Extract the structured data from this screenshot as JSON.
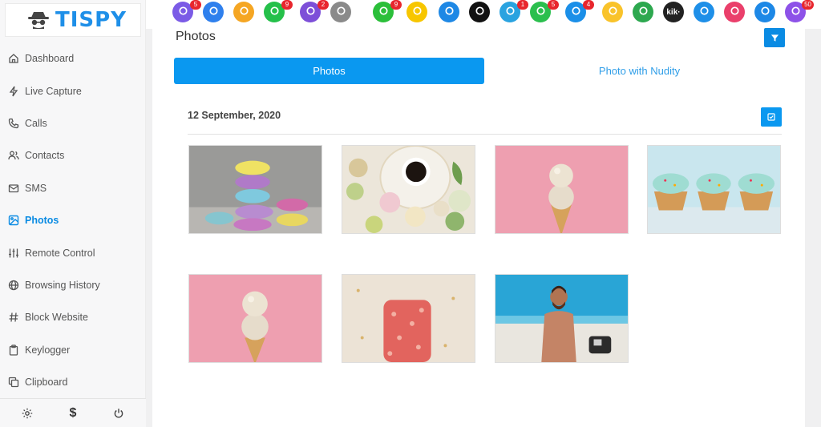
{
  "brand": {
    "name": "TISPY",
    "accent": "#1e8fe8"
  },
  "nav": {
    "items": [
      {
        "label": "Dashboard",
        "icon": "home-icon"
      },
      {
        "label": "Live Capture",
        "icon": "bolt-icon"
      },
      {
        "label": "Calls",
        "icon": "phone-icon"
      },
      {
        "label": "Contacts",
        "icon": "users-icon"
      },
      {
        "label": "SMS",
        "icon": "mail-icon"
      },
      {
        "label": "Photos",
        "icon": "image-icon",
        "active": true
      },
      {
        "label": "Remote Control",
        "icon": "sliders-icon"
      },
      {
        "label": "Browsing History",
        "icon": "globe-icon"
      },
      {
        "label": "Block Website",
        "icon": "hash-icon"
      },
      {
        "label": "Keylogger",
        "icon": "clipboard-icon"
      },
      {
        "label": "Clipboard",
        "icon": "copy-icon"
      }
    ],
    "footer": {
      "settings_icon": "gear-icon",
      "billing_label": "$",
      "power_icon": "power-icon"
    }
  },
  "apps": [
    {
      "name": "phone",
      "badge": "5",
      "color": "#7b5be6"
    },
    {
      "name": "email",
      "badge": "",
      "color": "#2f80ed"
    },
    {
      "name": "clipboard",
      "badge": "",
      "color": "#f5a623"
    },
    {
      "name": "whatsapp",
      "badge": "9",
      "color": "#25c04a"
    },
    {
      "name": "viber",
      "badge": "2",
      "color": "#7d4fd8"
    },
    {
      "name": "notes",
      "badge": "",
      "color": "#8a8a8a"
    },
    {
      "name": "wechat",
      "badge": "9",
      "color": "#2bbf3a"
    },
    {
      "name": "snapchat",
      "badge": "",
      "color": "#f7c600"
    },
    {
      "name": "flickr",
      "badge": "",
      "color": "#1e88e5"
    },
    {
      "name": "tiktok",
      "badge": "",
      "color": "#111111"
    },
    {
      "name": "telegram",
      "badge": "1",
      "color": "#2aa3e0"
    },
    {
      "name": "line",
      "badge": "5",
      "color": "#2bbf4e"
    },
    {
      "name": "skype",
      "badge": "4",
      "color": "#1b8fe8"
    },
    {
      "name": "kakao",
      "badge": "",
      "color": "#f9c32b"
    },
    {
      "name": "hangouts",
      "badge": "",
      "color": "#2da84f"
    },
    {
      "name": "kik",
      "badge": "",
      "color": "#222222",
      "label": "kik·"
    },
    {
      "name": "tinder",
      "badge": "",
      "color": "#1e8fe8"
    },
    {
      "name": "duo",
      "badge": "",
      "color": "#ea3f6b"
    },
    {
      "name": "hike",
      "badge": "",
      "color": "#1d88e6"
    },
    {
      "name": "viber-purple",
      "badge": "50",
      "color": "#8d52e8"
    }
  ],
  "page": {
    "title": "Photos",
    "filter_icon": "filter-icon",
    "tabs": [
      {
        "label": "Photos",
        "active": true
      },
      {
        "label": "Photo with Nudity",
        "active": false
      }
    ],
    "date_label": "12 September, 2020",
    "select_icon": "check-square-icon"
  },
  "photos": [
    {
      "name": "macarons-stack"
    },
    {
      "name": "macarons-coffee"
    },
    {
      "name": "ice-cream-cone-pink"
    },
    {
      "name": "cupcakes-blue"
    },
    {
      "name": "ice-cream-cone-pink-2"
    },
    {
      "name": "popsicle-red"
    },
    {
      "name": "man-beach"
    }
  ]
}
